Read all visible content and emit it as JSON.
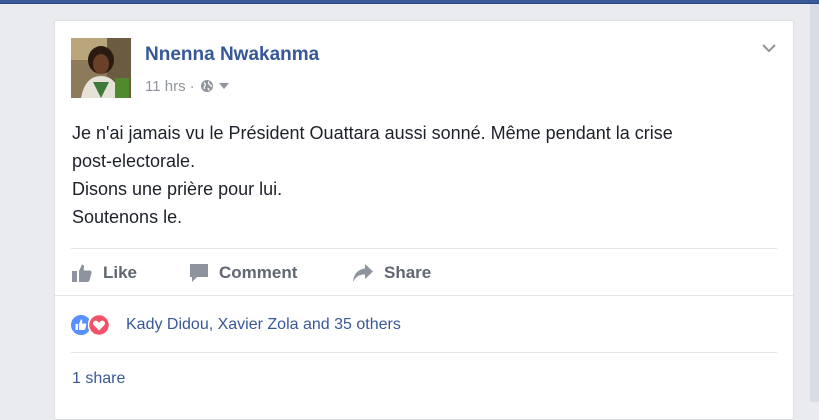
{
  "post": {
    "author": "Nnenna Nwakanma",
    "time": "11 hrs",
    "separator": "·",
    "audience_icon": "globe-icon",
    "menu_icon": "chevron-down-icon",
    "lines": [
      "Je n'ai jamais vu le Président Ouattara aussi sonné. Même pendant la crise",
      "post-electorale.",
      "Disons une prière pour lui.",
      "Soutenons le."
    ]
  },
  "actions": {
    "like": "Like",
    "comment": "Comment",
    "share": "Share"
  },
  "reactions": {
    "icons": [
      "like-reaction-icon",
      "love-reaction-icon"
    ],
    "summary": "Kady Didou, Xavier Zola and 35 others"
  },
  "shares": {
    "label": "1 share"
  },
  "colors": {
    "page_background": "#e9ebee",
    "name_blue": "#365899",
    "link_blue": "#385898",
    "text": "#1d2129",
    "muted": "#90949c",
    "like_blue": "#5890ff",
    "love_red": "#f25268",
    "header_bar": "#3b5998"
  }
}
